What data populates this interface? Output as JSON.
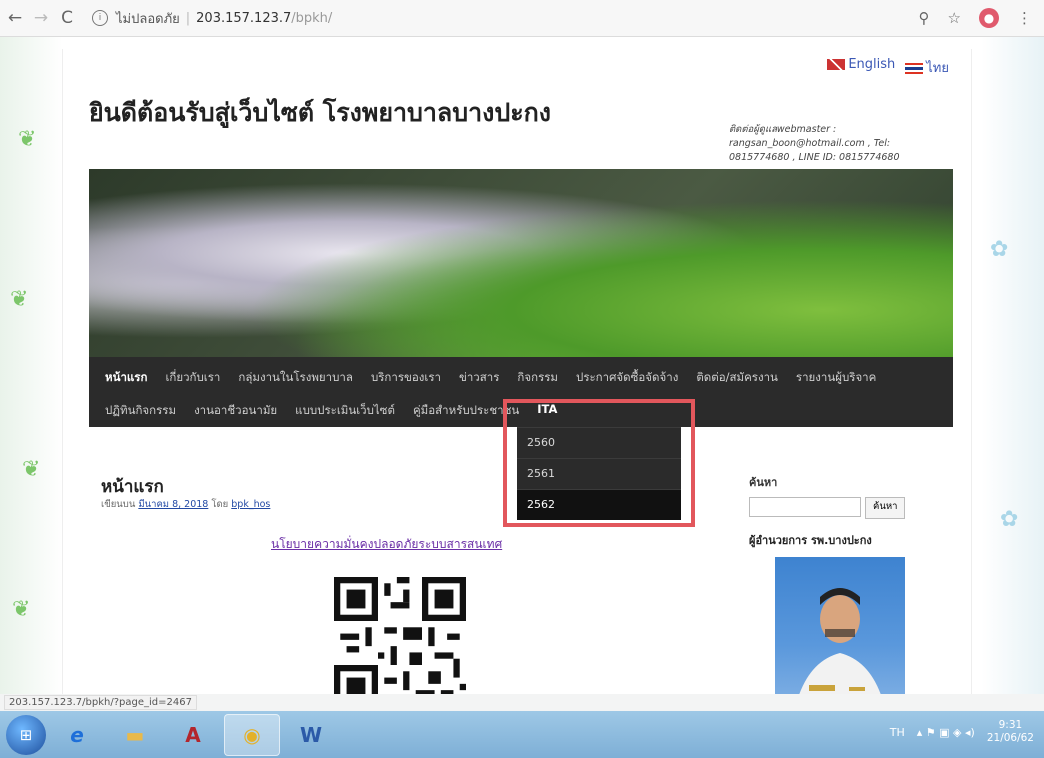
{
  "browser": {
    "back": "←",
    "forward": "→",
    "reload": "C",
    "security": "ไม่ปลอดภัย",
    "url_host": "203.157.123.7",
    "url_path": "/bpkh/",
    "zoom_icon": "⚲",
    "bookmark_icon": "☆",
    "menu_icon": "⋮"
  },
  "site": {
    "lang_english": "English",
    "lang_thai": "ไทย",
    "title": "ยินดีต้อนรับสู่เว็บไซต์ โรงพยาบาลบางปะกง",
    "contact": "ติดต่อผู้ดูแลwebmaster : rangsan_boon@hotmail.com , Tel: 0815774680 , LINE ID: 0815774680"
  },
  "menu": {
    "row1": [
      "หน้าแรก",
      "เกี่ยวกับเรา",
      "กลุ่มงานในโรงพยาบาล",
      "บริการของเรา",
      "ข่าวสาร",
      "กิจกรรม",
      "ประกาศจัดซื้อจัดจ้าง",
      "ติดต่อ/สมัครงาน",
      "รายงานผู้บริจาค"
    ],
    "row2": [
      "ปฏิทินกิจกรรม",
      "งานอาชีวอนามัย",
      "แบบประเมินเว็บไซต์",
      "คู่มือสำหรับประชาชน"
    ],
    "ita": "ITA",
    "dropdown": [
      "2560",
      "2561",
      "2562"
    ],
    "selected": "2562"
  },
  "post": {
    "title": "หน้าแรก",
    "meta_prefix": "เขียนบน",
    "date": "มีนาคม 8, 2018",
    "by": "โดย",
    "author": "bpk_hos",
    "policy_link": "นโยบายความมั่นคงปลอดภัยระบบสารสนเทศ"
  },
  "sidebar": {
    "search_heading": "ค้นหา",
    "search_button": "ค้นหา",
    "director_heading": "ผู้อำนวยการ รพ.บางปะกง"
  },
  "status_url": "203.157.123.7/bpkh/?page_id=2467",
  "taskbar": {
    "lang": "TH",
    "time": "9:31",
    "date": "21/06/62"
  }
}
